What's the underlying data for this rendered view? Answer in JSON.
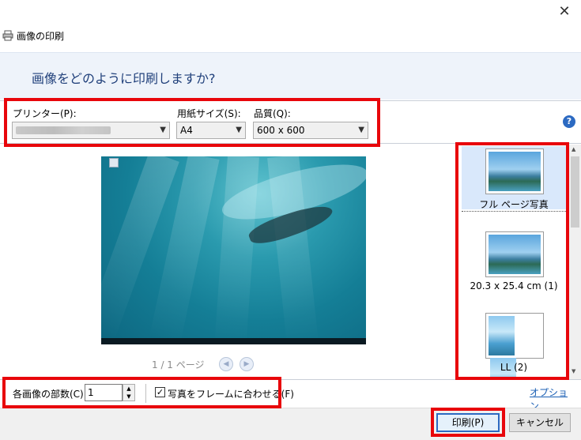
{
  "window": {
    "title": "画像の印刷",
    "close_glyph": "✕"
  },
  "header": {
    "question": "画像をどのように印刷しますか?"
  },
  "toolbar": {
    "printer_label": "プリンター(P):",
    "printer_value": "",
    "paper_label": "用紙サイズ(S):",
    "paper_value": "A4",
    "quality_label": "品質(Q):",
    "quality_value": "600 x 600",
    "help_glyph": "?"
  },
  "preview": {
    "page_info": "1 / 1 ページ",
    "prev_glyph": "◀",
    "next_glyph": "▶"
  },
  "layouts": [
    {
      "caption": "フル ページ写真",
      "selected": true
    },
    {
      "caption": "20.3 x 25.4 cm (1)",
      "selected": false
    },
    {
      "caption": "LL (2)",
      "selected": false
    }
  ],
  "bottom": {
    "copies_label": "各画像の部数(C):",
    "copies_value": "1",
    "fit_label": "写真をフレームに合わせる(F)",
    "fit_checked": "✓",
    "options_link": "オプション..."
  },
  "footer": {
    "print_label": "印刷(P)",
    "cancel_label": "キャンセル"
  },
  "colors": {
    "highlight_box": "#e8060b",
    "header_bg": "#eef3fa",
    "link": "#1a5fb4"
  }
}
